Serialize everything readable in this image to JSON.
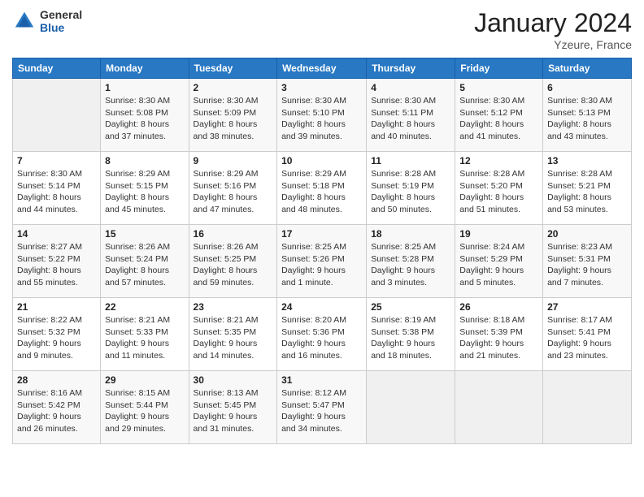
{
  "logo": {
    "general": "General",
    "blue": "Blue"
  },
  "header": {
    "title": "January 2024",
    "location": "Yzeure, France"
  },
  "columns": [
    "Sunday",
    "Monday",
    "Tuesday",
    "Wednesday",
    "Thursday",
    "Friday",
    "Saturday"
  ],
  "weeks": [
    [
      {
        "day": "",
        "sunrise": "",
        "sunset": "",
        "daylight": ""
      },
      {
        "day": "1",
        "sunrise": "Sunrise: 8:30 AM",
        "sunset": "Sunset: 5:08 PM",
        "daylight": "Daylight: 8 hours and 37 minutes."
      },
      {
        "day": "2",
        "sunrise": "Sunrise: 8:30 AM",
        "sunset": "Sunset: 5:09 PM",
        "daylight": "Daylight: 8 hours and 38 minutes."
      },
      {
        "day": "3",
        "sunrise": "Sunrise: 8:30 AM",
        "sunset": "Sunset: 5:10 PM",
        "daylight": "Daylight: 8 hours and 39 minutes."
      },
      {
        "day": "4",
        "sunrise": "Sunrise: 8:30 AM",
        "sunset": "Sunset: 5:11 PM",
        "daylight": "Daylight: 8 hours and 40 minutes."
      },
      {
        "day": "5",
        "sunrise": "Sunrise: 8:30 AM",
        "sunset": "Sunset: 5:12 PM",
        "daylight": "Daylight: 8 hours and 41 minutes."
      },
      {
        "day": "6",
        "sunrise": "Sunrise: 8:30 AM",
        "sunset": "Sunset: 5:13 PM",
        "daylight": "Daylight: 8 hours and 43 minutes."
      }
    ],
    [
      {
        "day": "7",
        "sunrise": "Sunrise: 8:30 AM",
        "sunset": "Sunset: 5:14 PM",
        "daylight": "Daylight: 8 hours and 44 minutes."
      },
      {
        "day": "8",
        "sunrise": "Sunrise: 8:29 AM",
        "sunset": "Sunset: 5:15 PM",
        "daylight": "Daylight: 8 hours and 45 minutes."
      },
      {
        "day": "9",
        "sunrise": "Sunrise: 8:29 AM",
        "sunset": "Sunset: 5:16 PM",
        "daylight": "Daylight: 8 hours and 47 minutes."
      },
      {
        "day": "10",
        "sunrise": "Sunrise: 8:29 AM",
        "sunset": "Sunset: 5:18 PM",
        "daylight": "Daylight: 8 hours and 48 minutes."
      },
      {
        "day": "11",
        "sunrise": "Sunrise: 8:28 AM",
        "sunset": "Sunset: 5:19 PM",
        "daylight": "Daylight: 8 hours and 50 minutes."
      },
      {
        "day": "12",
        "sunrise": "Sunrise: 8:28 AM",
        "sunset": "Sunset: 5:20 PM",
        "daylight": "Daylight: 8 hours and 51 minutes."
      },
      {
        "day": "13",
        "sunrise": "Sunrise: 8:28 AM",
        "sunset": "Sunset: 5:21 PM",
        "daylight": "Daylight: 8 hours and 53 minutes."
      }
    ],
    [
      {
        "day": "14",
        "sunrise": "Sunrise: 8:27 AM",
        "sunset": "Sunset: 5:22 PM",
        "daylight": "Daylight: 8 hours and 55 minutes."
      },
      {
        "day": "15",
        "sunrise": "Sunrise: 8:26 AM",
        "sunset": "Sunset: 5:24 PM",
        "daylight": "Daylight: 8 hours and 57 minutes."
      },
      {
        "day": "16",
        "sunrise": "Sunrise: 8:26 AM",
        "sunset": "Sunset: 5:25 PM",
        "daylight": "Daylight: 8 hours and 59 minutes."
      },
      {
        "day": "17",
        "sunrise": "Sunrise: 8:25 AM",
        "sunset": "Sunset: 5:26 PM",
        "daylight": "Daylight: 9 hours and 1 minute."
      },
      {
        "day": "18",
        "sunrise": "Sunrise: 8:25 AM",
        "sunset": "Sunset: 5:28 PM",
        "daylight": "Daylight: 9 hours and 3 minutes."
      },
      {
        "day": "19",
        "sunrise": "Sunrise: 8:24 AM",
        "sunset": "Sunset: 5:29 PM",
        "daylight": "Daylight: 9 hours and 5 minutes."
      },
      {
        "day": "20",
        "sunrise": "Sunrise: 8:23 AM",
        "sunset": "Sunset: 5:31 PM",
        "daylight": "Daylight: 9 hours and 7 minutes."
      }
    ],
    [
      {
        "day": "21",
        "sunrise": "Sunrise: 8:22 AM",
        "sunset": "Sunset: 5:32 PM",
        "daylight": "Daylight: 9 hours and 9 minutes."
      },
      {
        "day": "22",
        "sunrise": "Sunrise: 8:21 AM",
        "sunset": "Sunset: 5:33 PM",
        "daylight": "Daylight: 9 hours and 11 minutes."
      },
      {
        "day": "23",
        "sunrise": "Sunrise: 8:21 AM",
        "sunset": "Sunset: 5:35 PM",
        "daylight": "Daylight: 9 hours and 14 minutes."
      },
      {
        "day": "24",
        "sunrise": "Sunrise: 8:20 AM",
        "sunset": "Sunset: 5:36 PM",
        "daylight": "Daylight: 9 hours and 16 minutes."
      },
      {
        "day": "25",
        "sunrise": "Sunrise: 8:19 AM",
        "sunset": "Sunset: 5:38 PM",
        "daylight": "Daylight: 9 hours and 18 minutes."
      },
      {
        "day": "26",
        "sunrise": "Sunrise: 8:18 AM",
        "sunset": "Sunset: 5:39 PM",
        "daylight": "Daylight: 9 hours and 21 minutes."
      },
      {
        "day": "27",
        "sunrise": "Sunrise: 8:17 AM",
        "sunset": "Sunset: 5:41 PM",
        "daylight": "Daylight: 9 hours and 23 minutes."
      }
    ],
    [
      {
        "day": "28",
        "sunrise": "Sunrise: 8:16 AM",
        "sunset": "Sunset: 5:42 PM",
        "daylight": "Daylight: 9 hours and 26 minutes."
      },
      {
        "day": "29",
        "sunrise": "Sunrise: 8:15 AM",
        "sunset": "Sunset: 5:44 PM",
        "daylight": "Daylight: 9 hours and 29 minutes."
      },
      {
        "day": "30",
        "sunrise": "Sunrise: 8:13 AM",
        "sunset": "Sunset: 5:45 PM",
        "daylight": "Daylight: 9 hours and 31 minutes."
      },
      {
        "day": "31",
        "sunrise": "Sunrise: 8:12 AM",
        "sunset": "Sunset: 5:47 PM",
        "daylight": "Daylight: 9 hours and 34 minutes."
      },
      {
        "day": "",
        "sunrise": "",
        "sunset": "",
        "daylight": ""
      },
      {
        "day": "",
        "sunrise": "",
        "sunset": "",
        "daylight": ""
      },
      {
        "day": "",
        "sunrise": "",
        "sunset": "",
        "daylight": ""
      }
    ]
  ]
}
